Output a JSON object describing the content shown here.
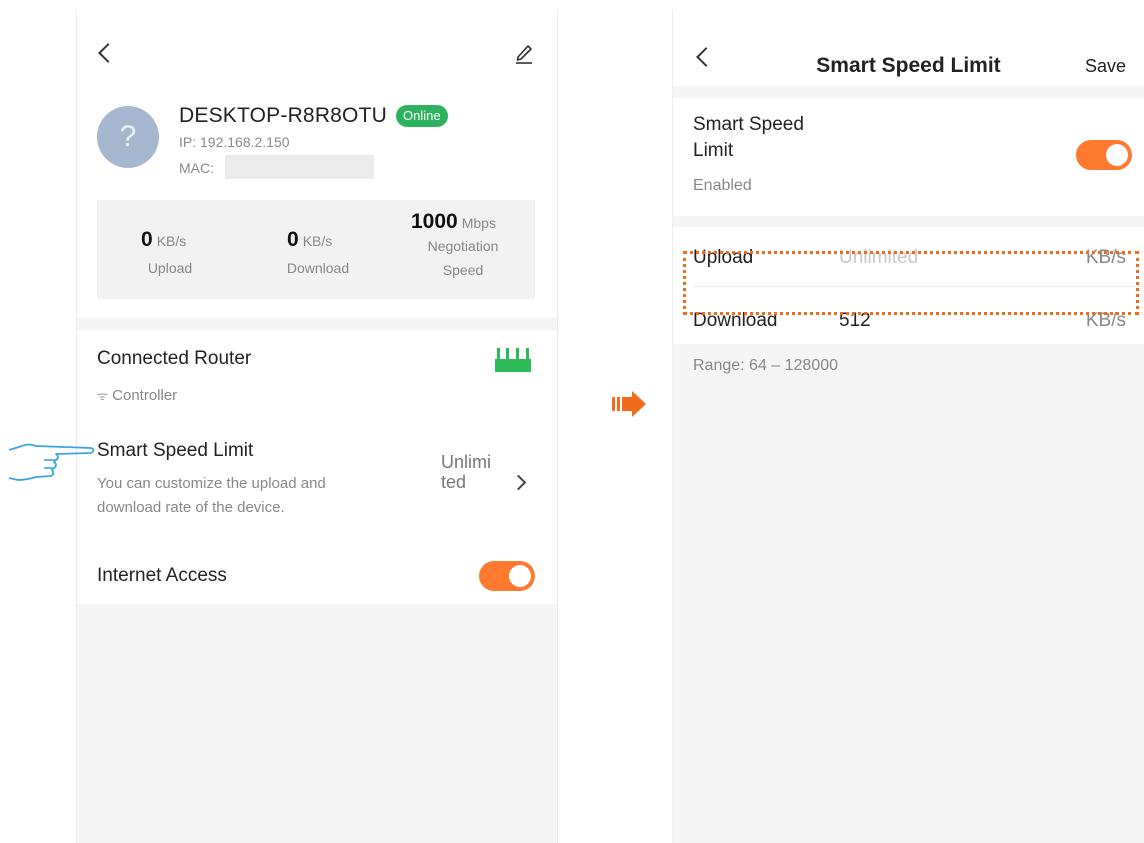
{
  "device_screen": {
    "device": {
      "name": "DESKTOP-R8R8OTU",
      "status": "Online",
      "ip": "IP: 192.168.2.150",
      "mac_label": "MAC:",
      "avatar_glyph": "?"
    },
    "stats": {
      "upload_value": "0",
      "upload_unit": "KB/s",
      "upload_label": "Upload",
      "download_value": "0",
      "download_unit": "KB/s",
      "download_label": "Download",
      "speed_value": "1000",
      "speed_unit": "Mbps",
      "speed_label_1": "Negotiation",
      "speed_label_2": "Speed"
    },
    "connected_router": {
      "title": "Connected Router",
      "subtitle": "Controller",
      "wifi_glyph": "ᯤ"
    },
    "smart_speed_limit": {
      "title": "Smart Speed Limit",
      "desc_1": "You can customize the upload and",
      "desc_2": "download rate of the device.",
      "value_1": "Unlimi",
      "value_2": "ted"
    },
    "internet_access": {
      "title": "Internet Access",
      "enabled": true
    }
  },
  "speed_limit_screen": {
    "title": "Smart Speed Limit",
    "save_label": "Save",
    "toggle_label_1": "Smart Speed",
    "toggle_label_2": "Limit",
    "toggle_status": "Enabled",
    "toggle_enabled": true,
    "upload": {
      "label": "Upload",
      "placeholder": "Unlimited",
      "unit": "KB/s"
    },
    "download": {
      "label": "Download",
      "value": "512",
      "unit": "KB/s"
    },
    "range": "Range: 64 – 128000"
  },
  "colors": {
    "accent_orange": "#ff7a2f",
    "online_green": "#2db35d",
    "router_green": "#2dbb5a",
    "highlight_orange": "#f26a1b",
    "pointer_blue": "#39a6de"
  },
  "icons": {
    "back": "back-arrow-icon",
    "edit": "edit-pencil-icon",
    "router": "router-icon",
    "wifi": "wifi-icon",
    "pointer": "pointing-hand-icon",
    "flow_arrow": "right-arrow-icon"
  }
}
